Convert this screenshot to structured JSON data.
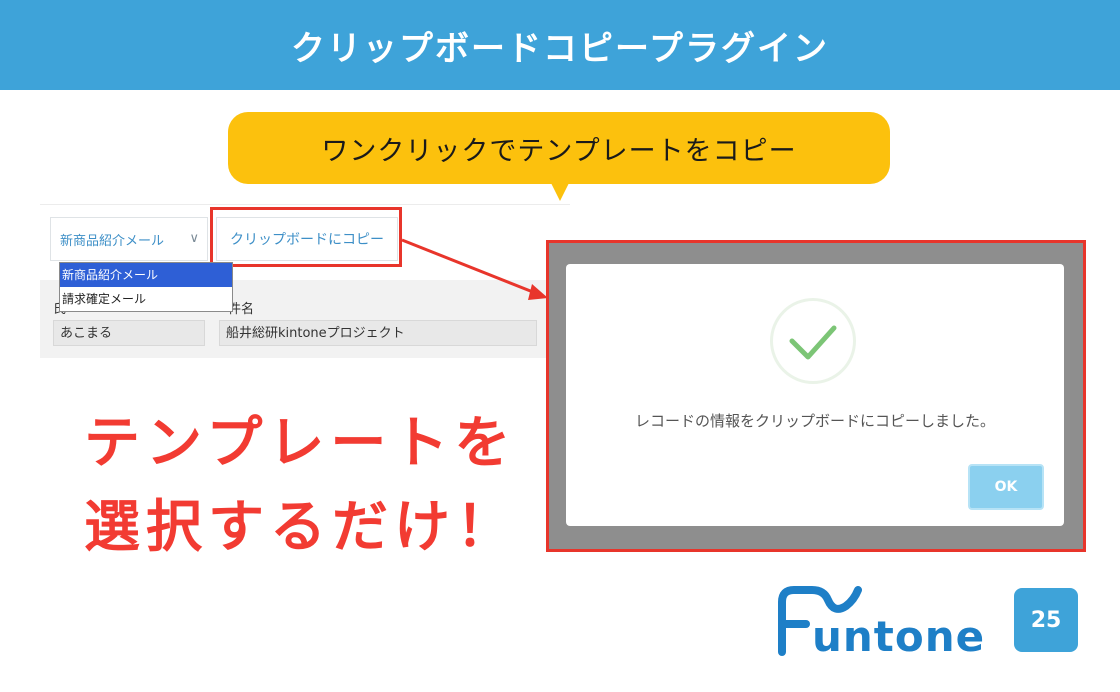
{
  "banner": {
    "title": "クリップボードコピープラグイン"
  },
  "callout": {
    "text": "ワンクリックでテンプレートをコピー"
  },
  "form": {
    "template_select": {
      "value": "新商品紹介メール"
    },
    "copy_button": {
      "label": "クリップボードにコピー"
    },
    "dropdown": {
      "options": [
        "新商品紹介メール",
        "請求確定メール"
      ],
      "selected_index": 0
    },
    "fields": [
      {
        "label": "氏",
        "value": "あこまる"
      },
      {
        "label": "件名",
        "value": "船井総研kintoneプロジェクト"
      }
    ]
  },
  "headline": {
    "line1": "テンプレートを",
    "line2": "選択するだけ！"
  },
  "dialog": {
    "icon": "check-icon",
    "message": "レコードの情報をクリップボードにコピーしました。",
    "ok_label": "OK"
  },
  "logo": {
    "text": "untone",
    "badge": "25"
  },
  "colors": {
    "banner": "#3ea3d9",
    "callout": "#fcc10d",
    "highlight": "#e8352b",
    "headline": "#f23b32",
    "dialog_button": "#8bd0ef",
    "check": "#7cc576"
  }
}
